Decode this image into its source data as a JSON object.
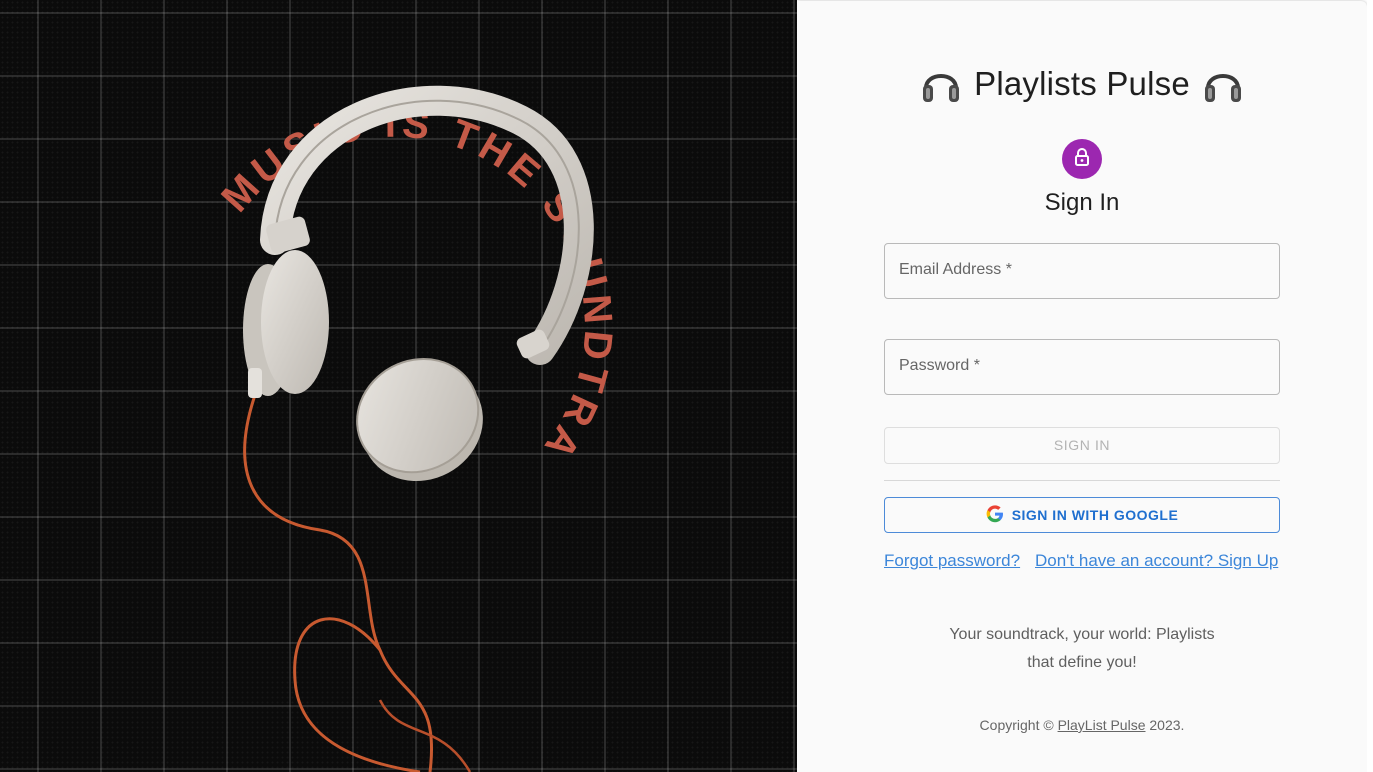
{
  "hero": {
    "arc_text": "MUSIC IS THE SOUNDTRACK OF LIFE"
  },
  "brand": {
    "title": "Playlists Pulse",
    "left_icon": "headphones-icon",
    "right_icon": "headphones-icon"
  },
  "form": {
    "heading": "Sign In",
    "avatar_icon": "lock-icon",
    "email_label": "Email Address *",
    "email_value": "",
    "password_label": "Password *",
    "password_value": "",
    "signin_button": "SIGN IN",
    "google_button": "SIGN IN WITH GOOGLE",
    "google_icon": "google-g-icon",
    "forgot_link": "Forgot password?",
    "signup_link": "Don't have an account? Sign Up"
  },
  "tagline": {
    "line1": "Your soundtrack, your world: Playlists",
    "line2": "that define you!"
  },
  "footer": {
    "prefix": "Copyright ©",
    "link": "PlayList Pulse",
    "suffix": "2023."
  },
  "colors": {
    "accent_purple": "#9c27b0",
    "link_blue": "#3c86d9",
    "arc_text_red": "#c45a48",
    "cable_orange": "#c85a30",
    "panel_bg": "#fafafa"
  }
}
